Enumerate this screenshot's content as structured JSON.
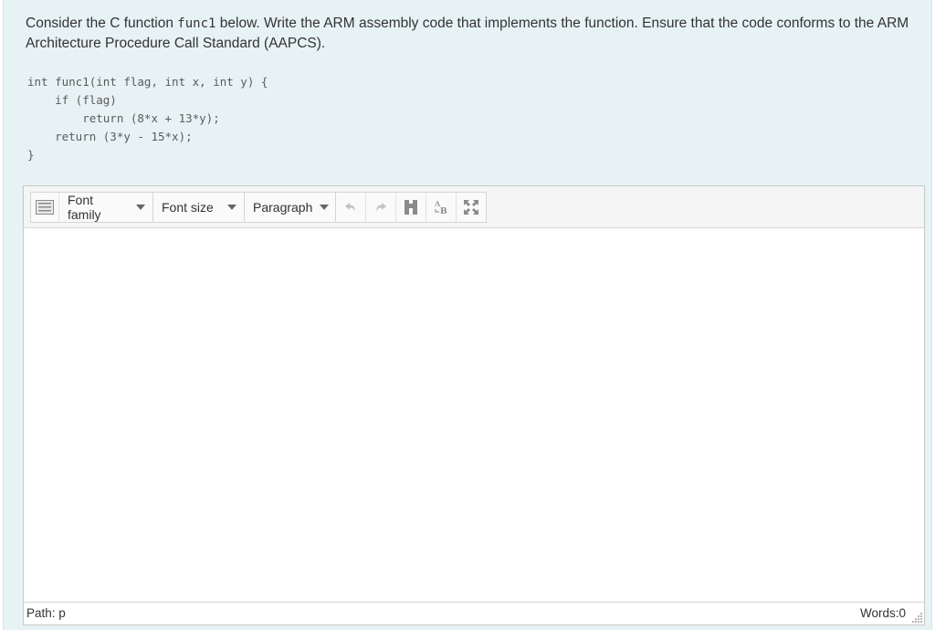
{
  "question": {
    "text_before": "Consider the C function ",
    "inline_code": "func1",
    "text_after": " below. Write the ARM assembly code that implements the function. Ensure that the code conforms to the ARM Architecture Procedure Call Standard (AAPCS)."
  },
  "code_lines": [
    "int func1(int flag, int x, int y) {",
    "    if (flag)",
    "        return (8*x + 13*y);",
    "    return (3*y - 15*x);",
    "}"
  ],
  "toolbar": {
    "font_family": "Font family",
    "font_size": "Font size",
    "paragraph": "Paragraph",
    "icons": [
      "keyboard-icon",
      "undo-icon",
      "redo-icon",
      "find-icon",
      "find-replace-icon",
      "fullscreen-icon"
    ]
  },
  "statusbar": {
    "path": "Path: p",
    "words": "Words:0"
  }
}
